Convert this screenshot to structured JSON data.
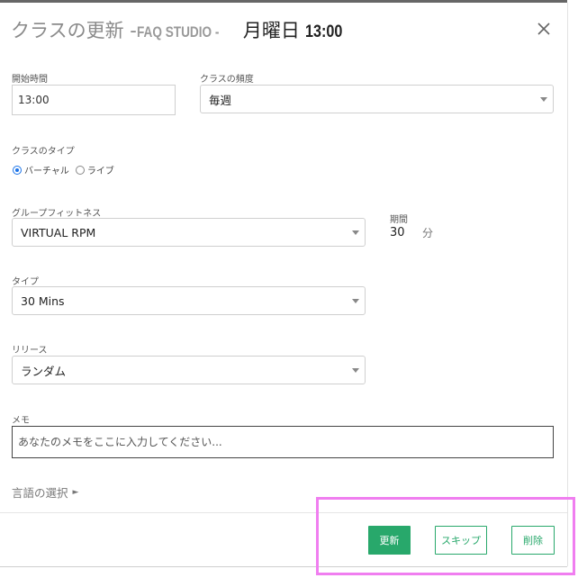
{
  "modal": {
    "title_main": "クラスの更新 - ",
    "title_studio": "FAQ STUDIO - ",
    "title_day": "月曜日",
    "title_time": "13:00",
    "close_icon": "close-icon"
  },
  "form": {
    "start_time": {
      "label": "開始時間",
      "value": "13:00"
    },
    "frequency": {
      "label": "クラスの頻度",
      "value": "毎週"
    },
    "class_type": {
      "label": "クラスのタイプ",
      "options": [
        {
          "label": "バーチャル",
          "selected": true
        },
        {
          "label": "ライブ",
          "selected": false
        }
      ]
    },
    "group_fitness": {
      "label": "グループフィットネス",
      "value": "VIRTUAL RPM"
    },
    "duration": {
      "label": "期間",
      "value": "30",
      "unit": "分"
    },
    "type": {
      "label": "タイプ",
      "value": "30 Mins"
    },
    "release": {
      "label": "リリース",
      "value": "ランダム"
    },
    "memo": {
      "label": "メモ",
      "placeholder": "あなたのメモをここに入力してください..."
    },
    "language": {
      "label": "言語の選択",
      "arrow": "►"
    }
  },
  "footer": {
    "update_label": "更新",
    "skip_label": "スキップ",
    "delete_label": "削除"
  },
  "colors": {
    "accent_green": "#28a86b",
    "radio_blue": "#1a73e8",
    "highlight_pink": "#f07ef0"
  }
}
